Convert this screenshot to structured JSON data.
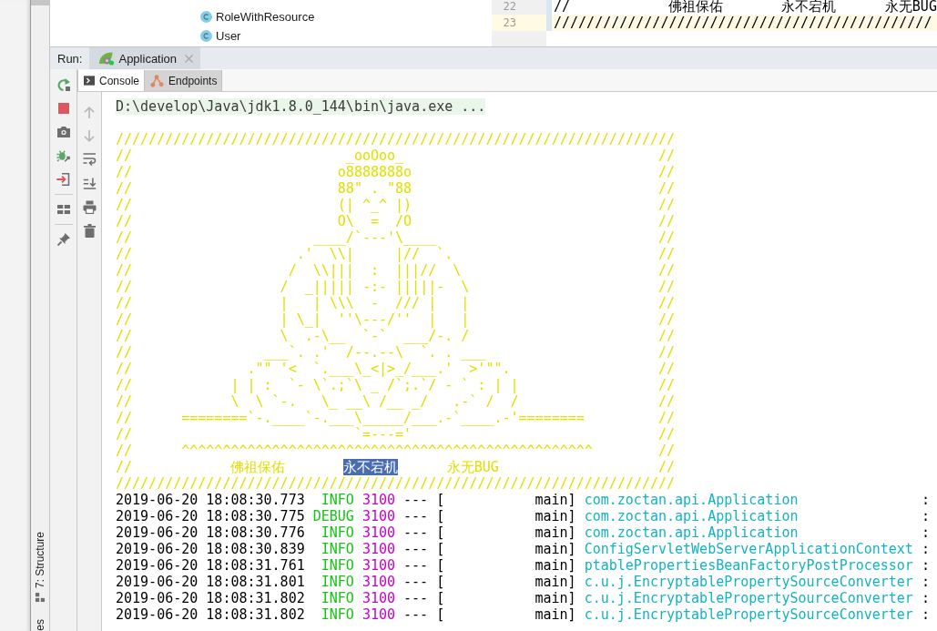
{
  "project_tree": {
    "items": [
      {
        "label": "RoleWithResource"
      },
      {
        "label": "User"
      }
    ]
  },
  "editor": {
    "lines": [
      {
        "number": "22",
        "text": "//            佛祖保佑       永不宕机      永无BUG",
        "current": false
      },
      {
        "number": "23",
        "text": "//////////////////////////////////////////////",
        "current": true
      }
    ]
  },
  "side_strip": {
    "tabs": [
      {
        "label": "7: Structure",
        "kind": "structure"
      },
      {
        "label": "es",
        "kind": "plain"
      }
    ]
  },
  "run_bar": {
    "label": "Run:",
    "tabs": [
      {
        "label": "Application",
        "selected": true
      }
    ]
  },
  "console_tabs": [
    {
      "label": "Console",
      "kind": "console",
      "selected": true
    },
    {
      "label": "Endpoints",
      "kind": "endpoints",
      "selected": false
    }
  ],
  "console_toolbar": [
    {
      "kind": "up",
      "disabled": true
    },
    {
      "kind": "down",
      "disabled": true
    },
    {
      "kind": "wrap",
      "disabled": false
    },
    {
      "kind": "scroll_end",
      "disabled": false
    },
    {
      "kind": "print",
      "disabled": false
    },
    {
      "kind": "clear",
      "disabled": false
    }
  ],
  "console": {
    "command": "D:\\develop\\Java\\jdk1.8.0_144\\bin\\java.exe ...",
    "banner": {
      "lines": [
        "////////////////////////////////////////////////////////////////////",
        "//                          _ooOoo_                               //",
        "//                         o8888888o                              //",
        "//                         88\" . \"88                              //",
        "//                         (| ^_^ |)                              //",
        "//                         O\\  =  /O                              //",
        "//                      ____/`---'\\____                           //",
        "//                    .'  \\\\|     |//  `.                         //",
        "//                   /  \\\\|||  :  |||//  \\                        //",
        "//                  /  _||||| -:- |||||-  \\                       //",
        "//                  |   | \\\\\\  -  /// |   |                       //",
        "//                  | \\_|  ''\\---/''  |   |                       //",
        "//                  \\  .-\\__  `-`  ___/-. /                       //",
        "//                ___`. .'  /--.--\\  `. . ___                     //",
        "//              .\"\" '<  `.___\\_<|>_/___.'  >'\"\".                  //",
        "//            | | :  `- \\`.;`\\ _ /`;.`/ - ` : | |                 //",
        "//            \\  \\ `-.   \\_ __\\ /__ _/   .-` /  /                 //",
        "//      ========`-.____`-.___\\_____/___.-`____.-'========         //",
        "//                           `=---='                              //",
        "//      ^^^^^^^^^^^^^^^^^^^^^^^^^^^^^^^^^^^^^^^^^^^^^^^^^^        //"
      ],
      "motto": {
        "edge_left": "//",
        "words": [
          {
            "text": "佛祖保佑",
            "selected": false
          },
          {
            "text": "永不宕机",
            "selected": true
          },
          {
            "text": "永无BUG",
            "selected": false
          }
        ],
        "edge_right": "//"
      },
      "closing_line": "////////////////////////////////////////////////////////////////////"
    },
    "log": [
      {
        "timestamp": "2019-06-20 18:08:30.773",
        "level": "INFO",
        "pid": "3100",
        "separator": "---",
        "bracket": "[",
        "thread": "main]",
        "logger": "com.zoctan.api.Application",
        "delimiter": ":"
      },
      {
        "timestamp": "2019-06-20 18:08:30.775",
        "level": "DEBUG",
        "pid": "3100",
        "separator": "---",
        "bracket": "[",
        "thread": "main]",
        "logger": "com.zoctan.api.Application",
        "delimiter": ":"
      },
      {
        "timestamp": "2019-06-20 18:08:30.776",
        "level": "INFO",
        "pid": "3100",
        "separator": "---",
        "bracket": "[",
        "thread": "main]",
        "logger": "com.zoctan.api.Application",
        "delimiter": ":"
      },
      {
        "timestamp": "2019-06-20 18:08:30.839",
        "level": "INFO",
        "pid": "3100",
        "separator": "---",
        "bracket": "[",
        "thread": "main]",
        "logger": "ConfigServletWebServerApplicationContext",
        "delimiter": ":"
      },
      {
        "timestamp": "2019-06-20 18:08:31.761",
        "level": "INFO",
        "pid": "3100",
        "separator": "---",
        "bracket": "[",
        "thread": "main]",
        "logger": "ptablePropertiesBeanFactoryPostProcessor",
        "delimiter": ":"
      },
      {
        "timestamp": "2019-06-20 18:08:31.801",
        "level": "INFO",
        "pid": "3100",
        "separator": "---",
        "bracket": "[",
        "thread": "main]",
        "logger": "c.u.j.EncryptablePropertySourceConverter",
        "delimiter": ":"
      },
      {
        "timestamp": "2019-06-20 18:08:31.802",
        "level": "INFO",
        "pid": "3100",
        "separator": "---",
        "bracket": "[",
        "thread": "main]",
        "logger": "c.u.j.EncryptablePropertySourceConverter",
        "delimiter": ":"
      },
      {
        "timestamp": "2019-06-20 18:08:31.802",
        "level": "INFO",
        "pid": "3100",
        "separator": "---",
        "bracket": "[",
        "thread": "main]",
        "logger": "c.u.j.EncryptablePropertySourceConverter",
        "delimiter": ":"
      }
    ]
  }
}
